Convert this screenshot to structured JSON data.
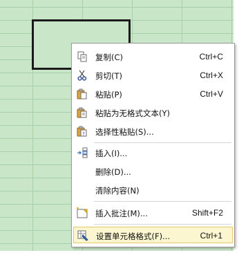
{
  "menu": {
    "items": [
      {
        "label": "复制(C)",
        "shortcut": "Ctrl+C",
        "icon": "copy-icon"
      },
      {
        "label": "剪切(T)",
        "shortcut": "Ctrl+X",
        "icon": "scissors-icon"
      },
      {
        "label": "粘贴(P)",
        "shortcut": "Ctrl+V",
        "icon": "paste-icon"
      },
      {
        "label": "粘贴为无格式文本(Y)",
        "shortcut": "",
        "icon": "paste-text-icon"
      },
      {
        "label": "选择性粘贴(S)...",
        "shortcut": "",
        "icon": "paste-special-icon"
      },
      {
        "label": "插入(I)...",
        "shortcut": "",
        "icon": "insert-cells-icon"
      },
      {
        "label": "删除(D)...",
        "shortcut": "",
        "icon": ""
      },
      {
        "label": "清除内容(N)",
        "shortcut": "",
        "icon": ""
      },
      {
        "label": "插入批注(M)...",
        "shortcut": "Shift+F2",
        "icon": "comment-icon"
      },
      {
        "label": "设置单元格格式(F)...",
        "shortcut": "Ctrl+1",
        "icon": "format-cells-icon",
        "highlighted": true
      }
    ]
  },
  "colors": {
    "sheet_bg": "#c9e6c9",
    "highlight": "#fbf6cf",
    "highlight_border": "#e7c868"
  }
}
